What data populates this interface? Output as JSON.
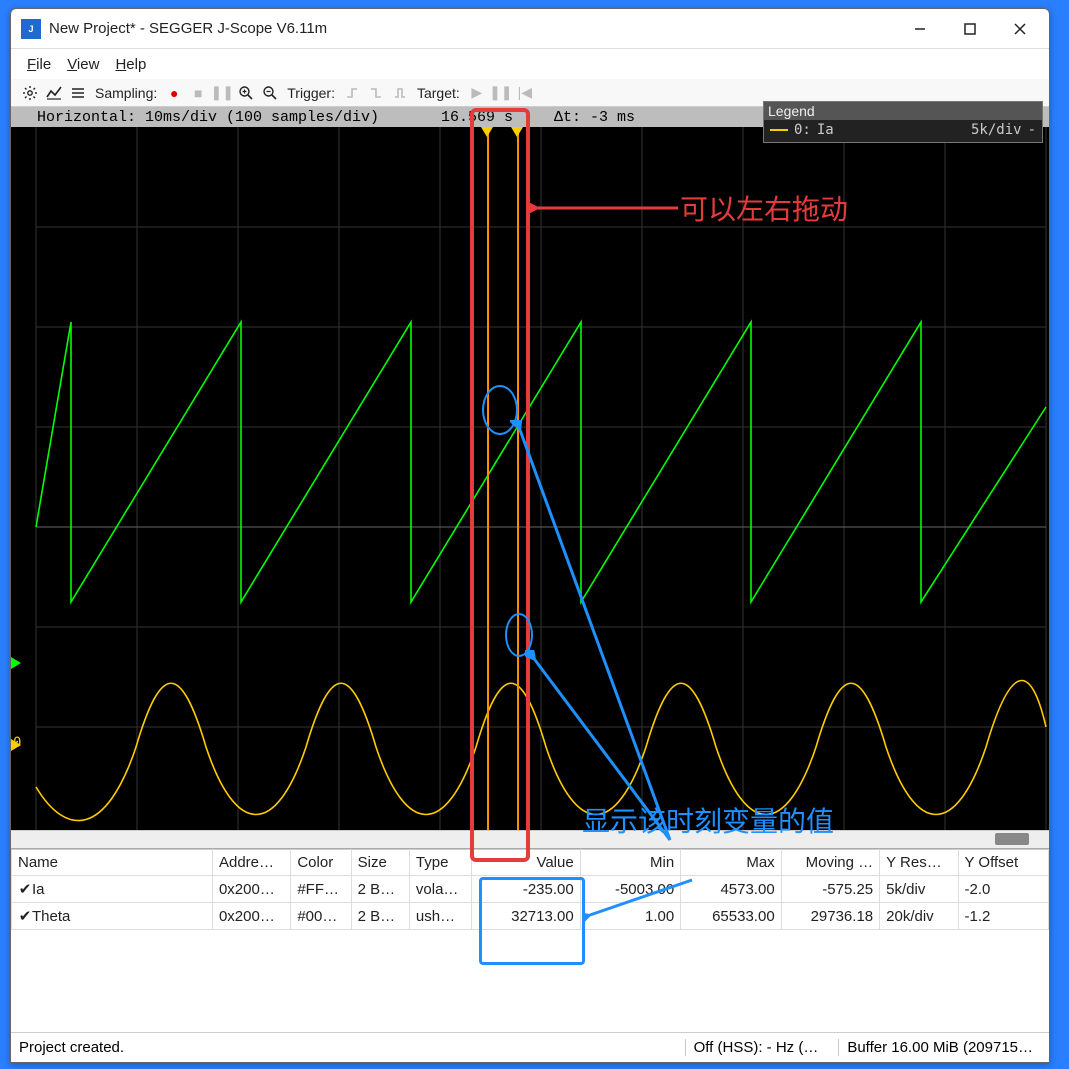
{
  "window": {
    "title": "New Project* - SEGGER J-Scope V6.11m"
  },
  "menu": {
    "file": "File",
    "view": "View",
    "help": "Help"
  },
  "toolbar": {
    "sampling_label": "Sampling:",
    "trigger_label": "Trigger:",
    "target_label": "Target:"
  },
  "scope": {
    "h_info": "Horizontal: 10ms/div (100 samples/div)",
    "t_abs": "16.569 s",
    "dt": "Δt: -3 ms",
    "legend_title": "Legend",
    "legend_row0_idx": "0:",
    "legend_row0_name": "Ia",
    "legend_row0_scale": "5k/div",
    "zero_label": "0"
  },
  "annotations": {
    "drag": "可以左右拖动",
    "value": "显示该时刻变量的值"
  },
  "table": {
    "headers": {
      "name": "Name",
      "addr": "Addre…",
      "color": "Color",
      "size": "Size",
      "type": "Type",
      "value": "Value",
      "min": "Min",
      "max": "Max",
      "mavg": "Moving …",
      "yres": "Y Res…",
      "yoff": "Y Offset"
    },
    "rows": [
      {
        "name": "Ia",
        "addr": "0x200…",
        "color": "#FF…",
        "size": "2 B…",
        "type": "vola…",
        "value": "-235.00",
        "min": "-5003.00",
        "max": "4573.00",
        "mavg": "-575.25",
        "yres": "5k/div",
        "yoff": "-2.0"
      },
      {
        "name": "Theta",
        "addr": "0x200…",
        "color": "#00…",
        "size": "2 B…",
        "type": "ush…",
        "value": "32713.00",
        "min": "1.00",
        "max": "65533.00",
        "mavg": "29736.18",
        "yres": "20k/div",
        "yoff": "-1.2"
      }
    ]
  },
  "status": {
    "msg": "Project created.",
    "hss": "Off (HSS): - Hz (…",
    "buf": "Buffer 16.00 MiB (209715…"
  },
  "chart_data": {
    "type": "line",
    "title": "",
    "x_unit": "ms",
    "x_per_div": 10,
    "divs_x": 10,
    "cursor_time_s": 16.569,
    "cursor_dt_ms": -3,
    "series": [
      {
        "name": "Ia",
        "color": "#ffcc00",
        "y_res": "5k/div",
        "y_offset": -2.0,
        "shape": "sine",
        "period_ms": 17,
        "amp": 4800,
        "value_at_cursor": -235.0,
        "min": -5003.0,
        "max": 4573.0,
        "moving_avg": -575.25
      },
      {
        "name": "Theta",
        "color": "#00ff00",
        "y_res": "20k/div",
        "y_offset": -1.2,
        "shape": "sawtooth",
        "period_ms": 17,
        "amp": 65533,
        "value_at_cursor": 32713.0,
        "min": 1.0,
        "max": 65533.0,
        "moving_avg": 29736.18
      }
    ]
  }
}
